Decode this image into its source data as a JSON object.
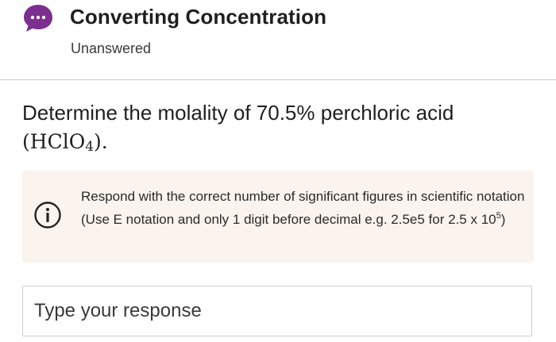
{
  "header": {
    "title": "Converting Concentration",
    "status": "Unanswered",
    "chat_icon": "chat-bubble-icon",
    "accent_color": "#7b2f8f"
  },
  "question": {
    "text": "Determine the molality of 70.5% perchloric acid",
    "formula_open": "(",
    "formula_main": "HClO",
    "formula_sub": "4",
    "formula_close": ").",
    "formula_end": ""
  },
  "hint": {
    "icon": "info-icon",
    "text_before_exp": "Respond with the correct number of significant figures in scientific notation (Use E notation and only 1 digit before decimal e.g. 2.5e5 for 2.5 x 10",
    "exponent": "5",
    "text_after_exp": ")",
    "background_color": "#fbf4ee"
  },
  "response": {
    "placeholder": "Type your response",
    "value": ""
  }
}
